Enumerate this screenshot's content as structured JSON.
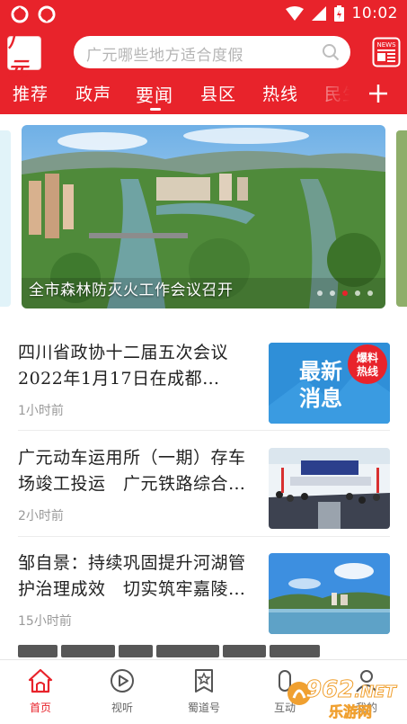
{
  "status_bar": {
    "time": "10:02"
  },
  "header": {
    "logo_text": "广元",
    "search_placeholder": "广元哪些地方适合度假",
    "news_button_label": "NEWS"
  },
  "tabs": [
    {
      "label": "推荐"
    },
    {
      "label": "政声"
    },
    {
      "label": "要闻"
    },
    {
      "label": "县区"
    },
    {
      "label": "热线"
    },
    {
      "label": "民生"
    }
  ],
  "active_tab_index": 2,
  "carousel": {
    "caption": "全市森林防灭火工作会议召开",
    "slide_count": 5,
    "active_slide": 2
  },
  "news": [
    {
      "title_lines": [
        "四川省政协十二届五次会议",
        "2022年1月17日在成都…"
      ],
      "time": "1小时前",
      "thumb": {
        "line1": "最新",
        "line2": "消息",
        "badge1": "爆料",
        "badge2": "热线"
      }
    },
    {
      "title_lines": [
        "广元动车运用所（一期）存车",
        "场竣工投运　广元铁路综合…"
      ],
      "time": "2小时前"
    },
    {
      "title_lines": [
        "邹自景：持续巩固提升河湖管",
        "护治理成效　切实筑牢嘉陵…"
      ],
      "time": "15小时前"
    }
  ],
  "bottom_nav": [
    {
      "label": "首页",
      "icon": "home-icon"
    },
    {
      "label": "视听",
      "icon": "play-icon"
    },
    {
      "label": "蜀道号",
      "icon": "star-badge-icon"
    },
    {
      "label": "互动",
      "icon": "interact-icon"
    },
    {
      "label": "我的",
      "icon": "user-icon"
    }
  ],
  "watermark": {
    "text": "962",
    "sub": "乐游网",
    "suffix": ".NET"
  },
  "colors": {
    "brand_red": "#e8232b",
    "thumb_blue": "#2f8fd8"
  }
}
